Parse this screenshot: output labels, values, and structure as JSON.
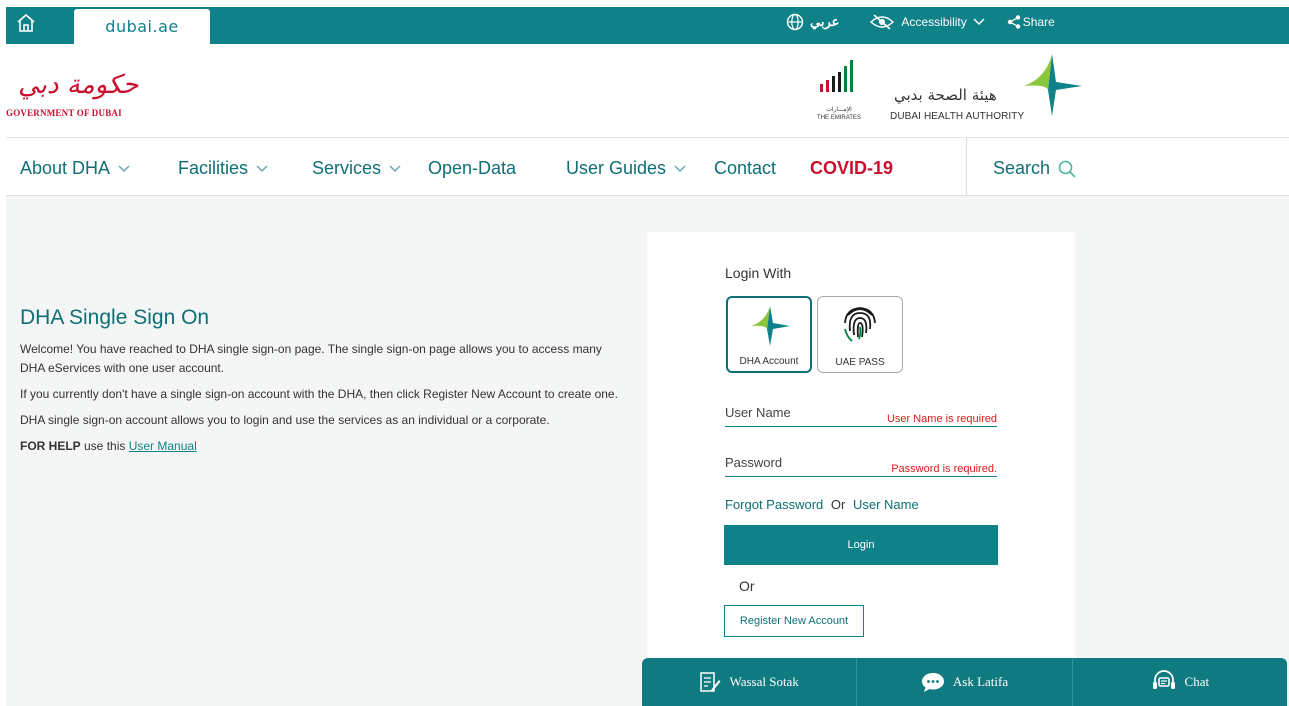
{
  "topbar": {
    "site_tab": "dubai.ae",
    "arabic_label": "عربي",
    "accessibility_label": "Accessibility",
    "share_label": "Share"
  },
  "header": {
    "gov_arabic": "حكومة دبي",
    "gov_english": "GOVERNMENT OF DUBAI",
    "uae_arabic": "الإمـــارات",
    "uae_english": "THE EMIRATES",
    "dha_arabic": "هيئة الصحة بدبي",
    "dha_english": "DUBAI HEALTH AUTHORITY"
  },
  "nav": {
    "items": [
      {
        "label": "About DHA",
        "dropdown": true
      },
      {
        "label": "Facilities",
        "dropdown": true
      },
      {
        "label": "Services",
        "dropdown": true
      },
      {
        "label": "Open-Data",
        "dropdown": false
      },
      {
        "label": "User Guides",
        "dropdown": true
      },
      {
        "label": "Contact",
        "dropdown": false
      },
      {
        "label": "COVID-19",
        "dropdown": false
      }
    ],
    "search_label": "Search"
  },
  "intro": {
    "title": "DHA Single Sign On",
    "p1": "Welcome! You have reached to DHA single sign-on page. The single sign-on page allows you to access many DHA eServices with one user account.",
    "p2": "If you currently don't have a single sign-on account with the DHA, then click Register New Account to create one.",
    "p3": "DHA single sign-on account allows you to login and use the services as an individual or a corporate.",
    "help_bold": "FOR HELP",
    "help_text": " use this ",
    "help_link": "User Manual"
  },
  "login": {
    "login_with": "Login With",
    "options": [
      "DHA Account",
      "UAE PASS"
    ],
    "username_placeholder": "User Name",
    "username_error": "User Name is required",
    "password_placeholder": "Password",
    "password_error": "Password is required.",
    "forgot_password": "Forgot Password",
    "or_text": "Or",
    "forgot_username": "User Name",
    "login_button": "Login",
    "or_separator": "Or",
    "register_button": "Register New Account"
  },
  "bottom_bar": {
    "items": [
      "Wassal Sotak",
      "Ask Latifa",
      "Chat"
    ]
  },
  "colors": {
    "primary": "#0f8289",
    "covid": "#c8102e",
    "error": "#d81b1b"
  }
}
